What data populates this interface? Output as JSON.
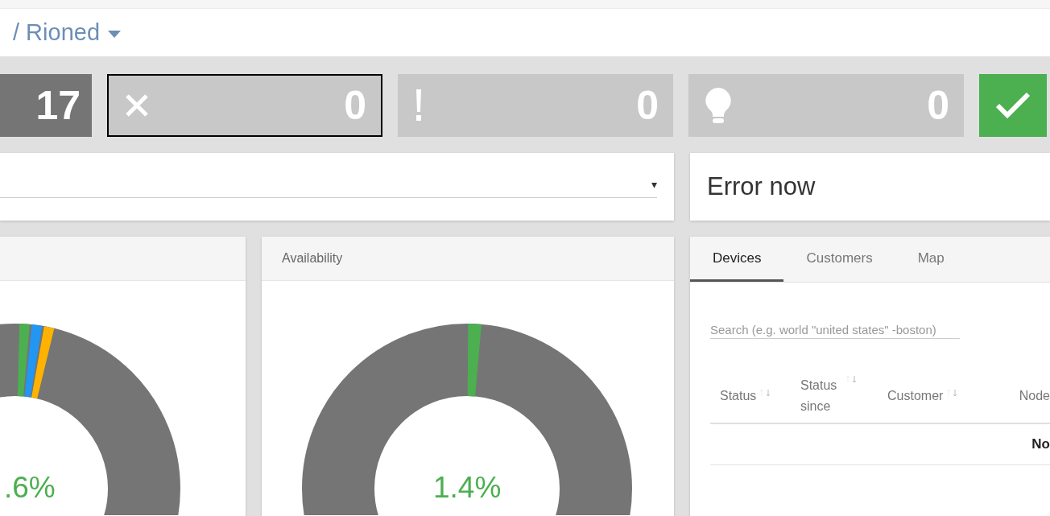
{
  "breadcrumb": {
    "label": "/ Rioned"
  },
  "status_tiles": [
    {
      "kind": "total",
      "count": "17",
      "selected": false
    },
    {
      "kind": "error",
      "count": "0",
      "selected": true
    },
    {
      "kind": "warning",
      "count": "0",
      "selected": false
    },
    {
      "kind": "info",
      "count": "0",
      "selected": false
    },
    {
      "kind": "ok",
      "selected": false
    }
  ],
  "filter_select": {
    "arrow": "▾"
  },
  "error_card": {
    "title": "Error now"
  },
  "panels": [
    {
      "kind": "mixed",
      "center_label": ".6%"
    },
    {
      "kind": "single",
      "title": "Availability",
      "center_label": "1.4%"
    }
  ],
  "devices_panel": {
    "tabs": [
      {
        "label": "Devices",
        "selected": true
      },
      {
        "label": "Customers",
        "selected": false
      },
      {
        "label": "Map",
        "selected": false
      }
    ],
    "search": {
      "placeholder": "Search (e.g. world \"united states\" -boston)"
    },
    "columns": [
      {
        "label": "Status",
        "sortable": true
      },
      {
        "label": "Status since",
        "sortable": true
      },
      {
        "label": "Customer",
        "sortable": true
      },
      {
        "label": "Node",
        "sortable": false
      }
    ],
    "rows": [
      {
        "node": "No"
      }
    ]
  }
}
